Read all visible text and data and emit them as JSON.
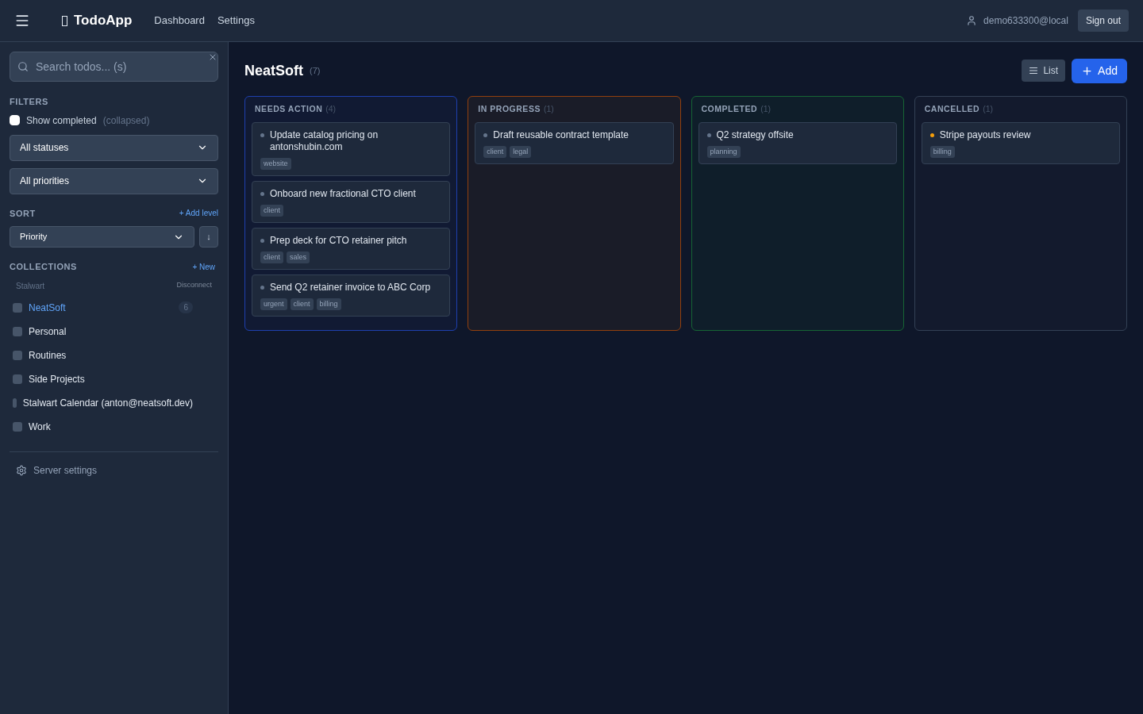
{
  "header": {
    "app_name": "TodoApp",
    "nav": [
      {
        "label": "Dashboard"
      },
      {
        "label": "Settings"
      }
    ],
    "user": "demo633300@local",
    "sign_out": "Sign out"
  },
  "sidebar": {
    "search": {
      "placeholder": "Search todos... (s)"
    },
    "filters": {
      "title": "FILTERS",
      "show_completed": {
        "label": "Show completed",
        "checked": false,
        "note": "(collapsed)"
      },
      "status": "All statuses",
      "priority": "All priorities"
    },
    "sort": {
      "title": "SORT",
      "add": "+ Add level",
      "field": "Priority",
      "direction": "↓"
    },
    "collections": {
      "title": "COLLECTIONS",
      "new": "+ New",
      "account": "Stalwart",
      "disconnect": "Disconnect",
      "items": [
        {
          "name": "NeatSoft",
          "count": "6",
          "selected": true
        },
        {
          "name": "Personal",
          "selected": false
        },
        {
          "name": "Routines",
          "selected": false
        },
        {
          "name": "Side Projects",
          "selected": false
        },
        {
          "name": "Stalwart Calendar (anton@neatsoft.dev)",
          "selected": false
        },
        {
          "name": "Work",
          "selected": false
        }
      ]
    },
    "server_settings": "Server settings"
  },
  "board": {
    "title": "NeatSoft",
    "count": "(7)",
    "list_button": "List",
    "add_button": "Add",
    "columns": [
      {
        "title": "NEEDS ACTION",
        "count": "(4)",
        "color": "#1e40af",
        "tasks": [
          {
            "title": "Update catalog pricing on antonshubin.com",
            "color": "#64748b",
            "tags": [
              "website"
            ]
          },
          {
            "title": "Onboard new fractional CTO client",
            "color": "#64748b",
            "tags": [
              "client"
            ]
          },
          {
            "title": "Prep deck for CTO retainer pitch",
            "color": "#64748b",
            "tags": [
              "client",
              "sales"
            ]
          },
          {
            "title": "Send Q2 retainer invoice to ABC Corp",
            "color": "#64748b",
            "tags": [
              "urgent",
              "client",
              "billing"
            ]
          }
        ]
      },
      {
        "title": "IN PROGRESS",
        "count": "(1)",
        "color": "#92400e",
        "tasks": [
          {
            "title": "Draft reusable contract template",
            "color": "#64748b",
            "tags": [
              "client",
              "legal"
            ]
          }
        ]
      },
      {
        "title": "COMPLETED",
        "count": "(1)",
        "color": "#166534",
        "tasks": [
          {
            "title": "Q2 strategy offsite",
            "color": "#64748b",
            "tags": [
              "planning"
            ]
          }
        ]
      },
      {
        "title": "CANCELLED",
        "count": "(1)",
        "color": "#334155",
        "tasks": [
          {
            "title": "Stripe payouts review",
            "color": "#f59e0b",
            "tags": [
              "billing"
            ]
          }
        ]
      }
    ]
  }
}
